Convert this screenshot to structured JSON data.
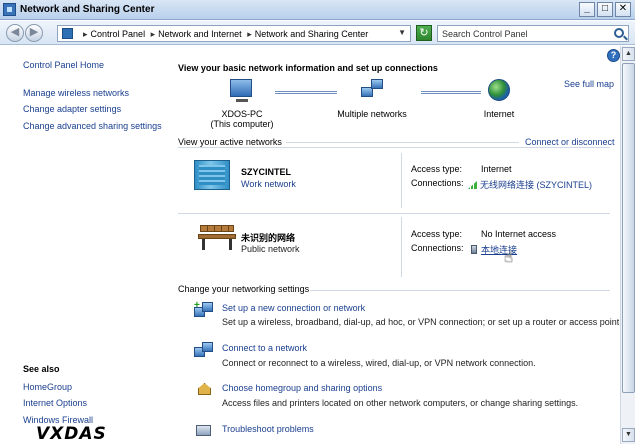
{
  "window": {
    "title": "Network and Sharing Center",
    "min_glyph": "_",
    "max_glyph": "□",
    "close_glyph": "✕"
  },
  "address": {
    "crumbs": [
      "Control Panel",
      "Network and Internet",
      "Network and Sharing Center"
    ],
    "search_placeholder": "Search Control Panel"
  },
  "left_pane": {
    "home": "Control Panel Home",
    "links": [
      "Manage wireless networks",
      "Change adapter settings",
      "Change advanced sharing settings"
    ],
    "see_also_title": "See also",
    "see_also": [
      "HomeGroup",
      "Internet Options",
      "Windows Firewall"
    ]
  },
  "main": {
    "title": "View your basic network information and set up connections",
    "see_full_map": "See full map",
    "map": {
      "pc_name": "XDOS-PC",
      "pc_sub": "(This computer)",
      "middle": "Multiple networks",
      "internet": "Internet"
    },
    "active_label": "View your active networks",
    "connect_disconnect": "Connect or disconnect",
    "networks": [
      {
        "name": "SZYCINTEL",
        "type": "Work network",
        "access_label": "Access type:",
        "access_value": "Internet",
        "conn_label": "Connections:",
        "conn_value": "无线网络连接 (SZYCINTEL)"
      },
      {
        "name": "未识别的网络",
        "type": "Public network",
        "access_label": "Access type:",
        "access_value": "No Internet access",
        "conn_label": "Connections:",
        "conn_value": "本地连接"
      }
    ],
    "change_label": "Change your networking settings",
    "tasks": [
      {
        "title": "Set up a new connection or network",
        "desc": "Set up a wireless, broadband, dial-up, ad hoc, or VPN connection; or set up a router or access point."
      },
      {
        "title": "Connect to a network",
        "desc": "Connect or reconnect to a wireless, wired, dial-up, or VPN network connection."
      },
      {
        "title": "Choose homegroup and sharing options",
        "desc": "Access files and printers located on other network computers, or change sharing settings."
      },
      {
        "title": "Troubleshoot problems",
        "desc": ""
      }
    ]
  },
  "watermark": "VXDAS"
}
